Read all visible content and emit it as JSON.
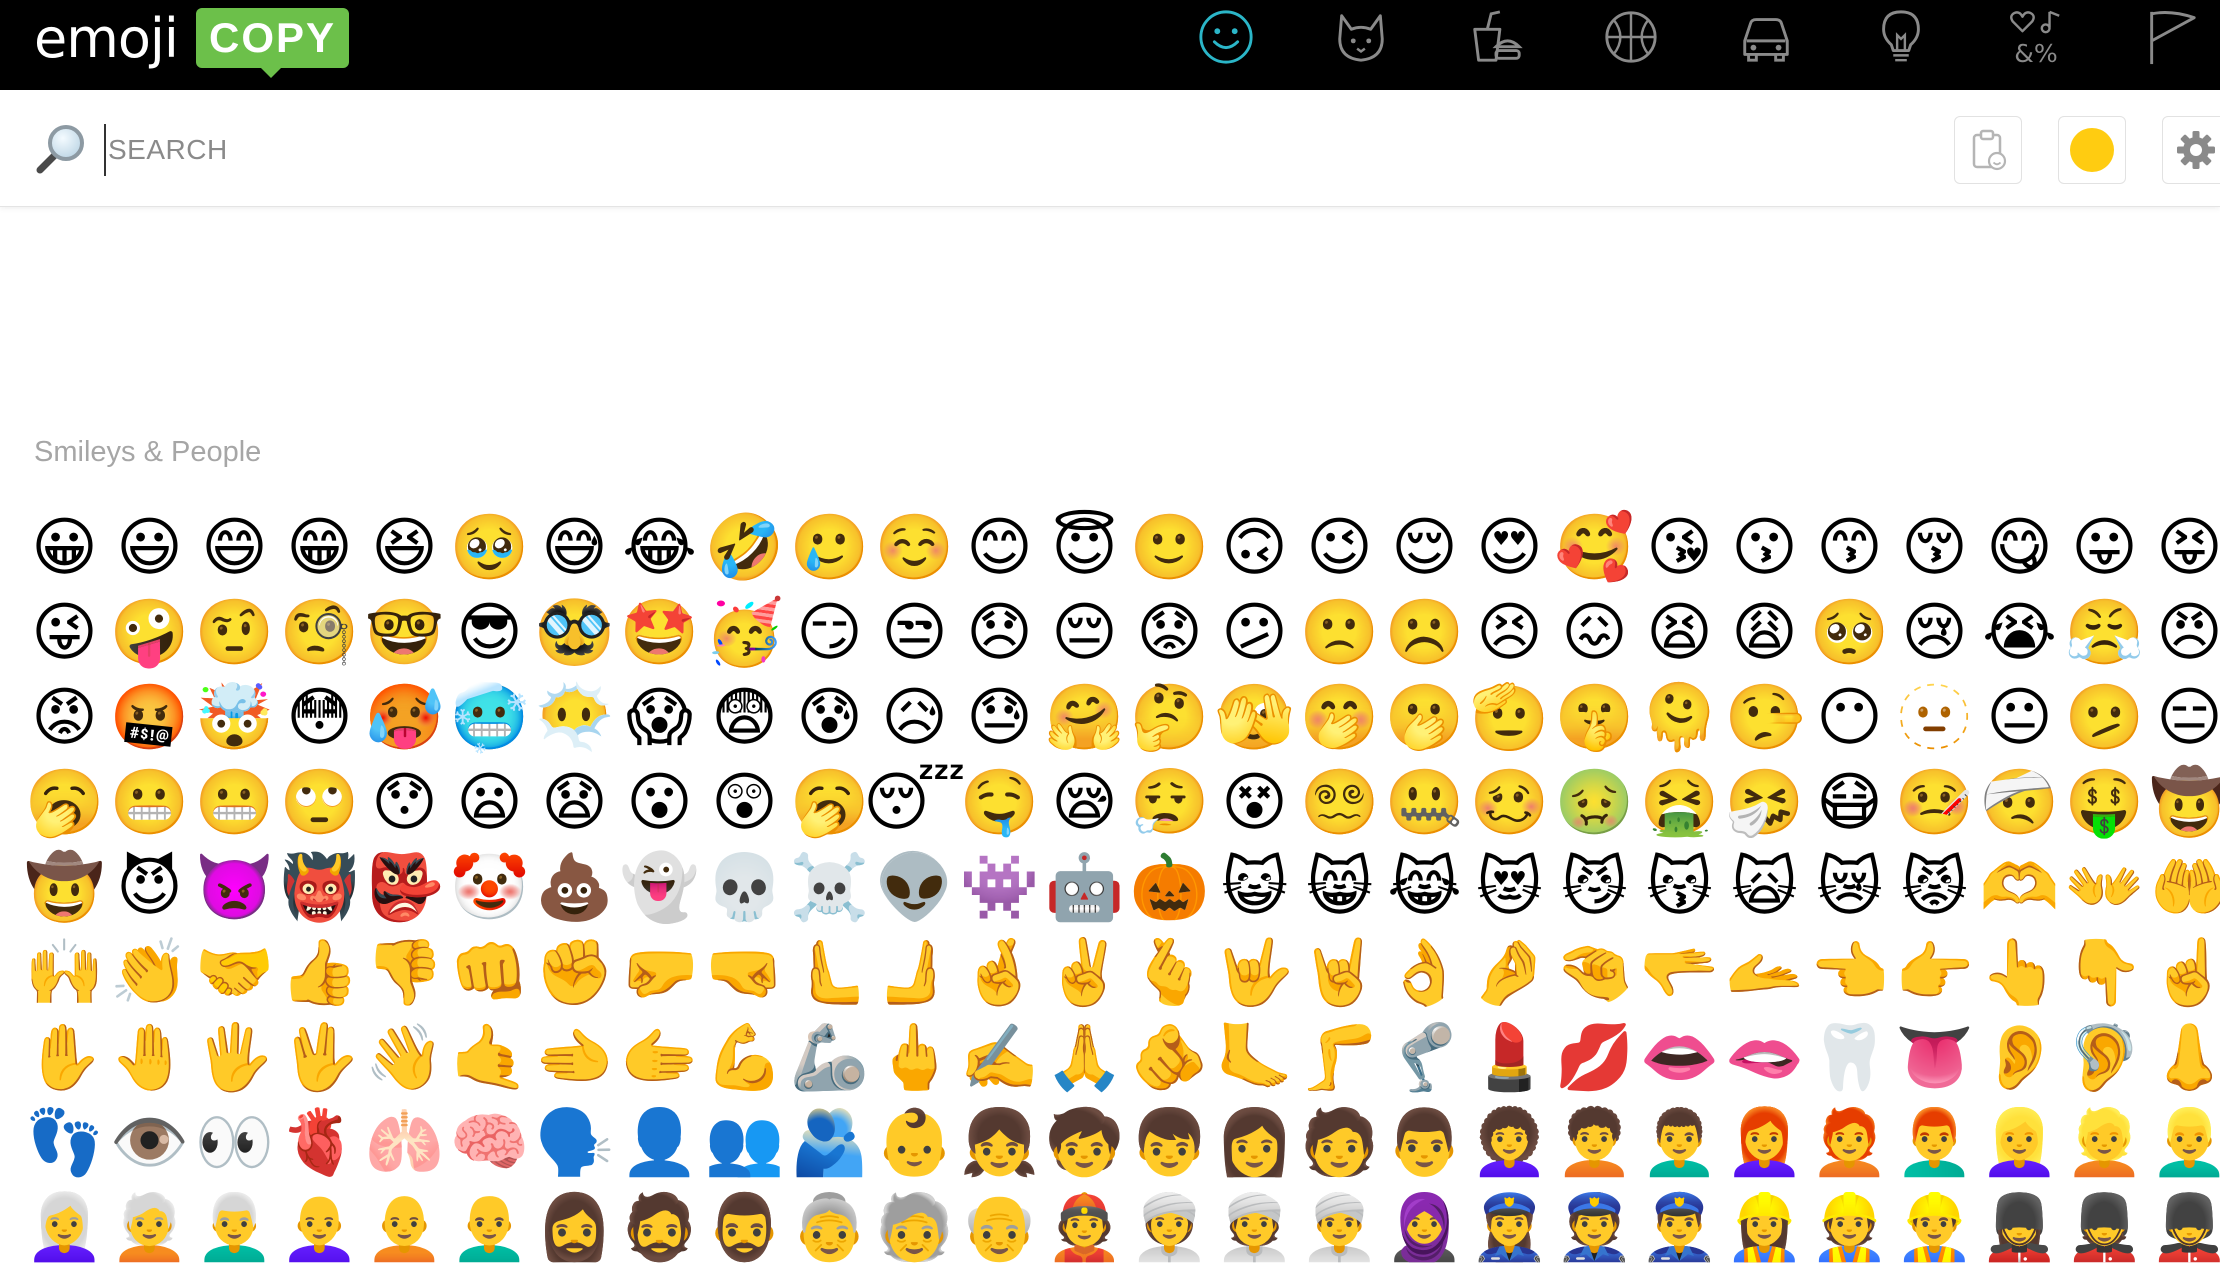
{
  "brand": {
    "name": "emoji",
    "badge": "COPY",
    "badge_color": "#6cc04a"
  },
  "nav": {
    "active_color": "#2bb6c8",
    "icon_color": "#8a8a8a",
    "categories": [
      {
        "icon": "smiley-icon",
        "active": true
      },
      {
        "icon": "cat-icon",
        "active": false
      },
      {
        "icon": "food-drink-icon",
        "active": false
      },
      {
        "icon": "basketball-icon",
        "active": false
      },
      {
        "icon": "car-icon",
        "active": false
      },
      {
        "icon": "lightbulb-icon",
        "active": false
      },
      {
        "icon": "symbols-icon",
        "active": false,
        "text": "&%"
      },
      {
        "icon": "flag-icon",
        "active": false
      }
    ]
  },
  "search": {
    "placeholder": "SEARCH",
    "value": "",
    "skin_tone_color": "#ffcc11"
  },
  "section": {
    "title": "Smileys & People",
    "emojis": [
      "😀",
      "😃",
      "😄",
      "😁",
      "😆",
      "🥹",
      "😅",
      "😂",
      "🤣",
      "🥲",
      "☺️",
      "😊",
      "😇",
      "🙂",
      "🙃",
      "😉",
      "😌",
      "😍",
      "🥰",
      "😘",
      "😗",
      "😙",
      "😚",
      "😋",
      "😛",
      "😝",
      "😜",
      "🤪",
      "🤨",
      "🧐",
      "🤓",
      "😎",
      "🥸",
      "🤩",
      "🥳",
      "😏",
      "😒",
      "😞",
      "😔",
      "😟",
      "😕",
      "🙁",
      "☹️",
      "😣",
      "😖",
      "😫",
      "😩",
      "🥺",
      "😢",
      "😭",
      "😤",
      "😠",
      "😡",
      "🤬",
      "🤯",
      "😳",
      "🥵",
      "🥶",
      "😶‍🌫️",
      "😱",
      "😨",
      "😰",
      "😥",
      "😓",
      "🤗",
      "🤔",
      "🫣",
      "🤭",
      "🫢",
      "🫡",
      "🤫",
      "🫠",
      "🤥",
      "😶",
      "🫥",
      "😐",
      "🫤",
      "😑",
      "🥱",
      "😬",
      "😬",
      "🙄",
      "😯",
      "😦",
      "😧",
      "😮",
      "😲",
      "🥱",
      "😴",
      "🤤",
      "😪",
      "😮‍💨",
      "😵",
      "😵‍💫",
      "🤐",
      "🥴",
      "🤢",
      "🤮",
      "🤧",
      "😷",
      "🤒",
      "🤕",
      "🤑",
      "🤠",
      "🤠",
      "😈",
      "👿",
      "👹",
      "👺",
      "🤡",
      "💩",
      "👻",
      "💀",
      "☠️",
      "👽",
      "👾",
      "🤖",
      "🎃",
      "😺",
      "😸",
      "😹",
      "😻",
      "😼",
      "😽",
      "🙀",
      "😿",
      "😾",
      "🫶",
      "👐",
      "🤲",
      "🙌",
      "👏",
      "🤝",
      "👍",
      "👎",
      "👊",
      "✊",
      "🤛",
      "🤜",
      "🫷",
      "🫸",
      "🤞",
      "✌️",
      "🫰",
      "🤟",
      "🤘",
      "👌",
      "🤌",
      "🤏",
      "🫳",
      "🫴",
      "👈",
      "👉",
      "👆",
      "👇",
      "☝️",
      "✋",
      "🤚",
      "🖐️",
      "🖖",
      "👋",
      "🤙",
      "🫲",
      "🫱",
      "💪",
      "🦾",
      "🖕",
      "✍️",
      "🙏",
      "🫵",
      "🦶",
      "🦵",
      "🦿",
      "💄",
      "💋",
      "👄",
      "🫦",
      "🦷",
      "👅",
      "👂",
      "🦻",
      "👃",
      "👣",
      "👁️",
      "👀",
      "🫀",
      "🫁",
      "🧠",
      "🗣️",
      "👤",
      "👥",
      "🫂",
      "👶",
      "👧",
      "🧒",
      "👦",
      "👩",
      "🧑",
      "👨",
      "👩‍🦱",
      "🧑‍🦱",
      "👨‍🦱",
      "👩‍🦰",
      "🧑‍🦰",
      "👨‍🦰",
      "👱‍♀️",
      "👱",
      "👱‍♂️",
      "👩‍🦳",
      "🧑‍🦳",
      "👨‍🦳",
      "👩‍🦲",
      "🧑‍🦲",
      "👨‍🦲",
      "🧔‍♀️",
      "🧔",
      "🧔‍♂️",
      "👵",
      "🧓",
      "👴",
      "👲",
      "👳‍♀️",
      "👳",
      "👳‍♂️",
      "🧕",
      "👮‍♀️",
      "👮",
      "👮‍♂️",
      "👷‍♀️",
      "👷",
      "👷‍♂️",
      "💂‍♀️",
      "💂",
      "💂‍♂️"
    ]
  }
}
